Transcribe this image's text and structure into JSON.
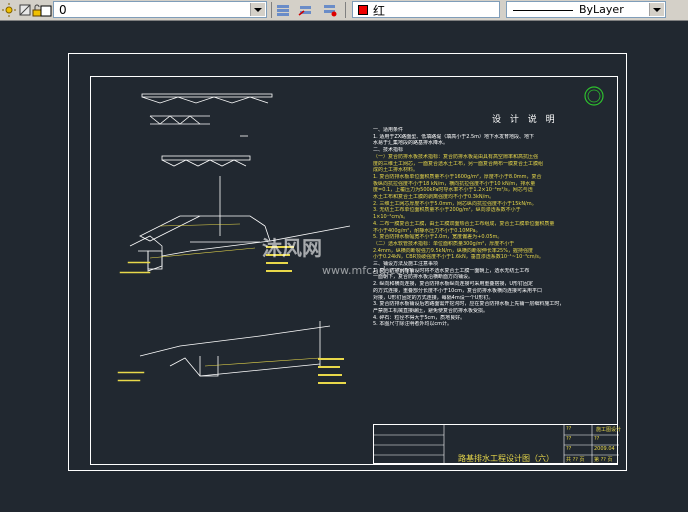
{
  "toolbar": {
    "layer_value": "0",
    "color_value": "红",
    "color_hex": "#e00000",
    "linetype_value": "ByLayer",
    "icons": [
      "sun-icon",
      "lock-icon",
      "layer-color-icon",
      "layer-props-icon",
      "layer-prev-icon",
      "layer-state-icon"
    ]
  },
  "drawing": {
    "title": "设 计 说 明",
    "notes": [
      {
        "t": "一、适用条件",
        "c": "w"
      },
      {
        "t": "1. 适用于ZX路面型、低填路堤（填高小于2.5m）地下水发育地段、地下",
        "c": "w"
      },
      {
        "t": "水易于汇集地段的路基排水降水。",
        "c": "w"
      },
      {
        "t": "二、技术指标",
        "c": "w"
      },
      {
        "t": "（一）复合防排水板技术指标：复合防排水板是由具有高空隙率和高抗压强",
        "c": "y"
      },
      {
        "t": "度的三维土工网芯，一面复合透水土工布，另一面复合两布一膜复合土工膜组",
        "c": "y"
      },
      {
        "t": "成的土工排水材料。",
        "c": "y"
      },
      {
        "t": "1. 复合防排水板单位面积质量不小于1600g/m²，厚度不小于8.0mm，复合",
        "c": "y"
      },
      {
        "t": "板纵向抗拉强度不小于18 kN/m，横向抗拉强度不小于10 kN/m，排水量",
        "c": "y"
      },
      {
        "t": "度=0.1，上覆压力为500kPa时导水率不小于1.2×10⁻⁴m²/s，网芯与透",
        "c": "y"
      },
      {
        "t": "水土工布和复合土工膜的剥离强度均不小于0.3kN/m。",
        "c": "y"
      },
      {
        "t": "2. 三维土工网芯厚度不小于5.0mm，网芯纵向抗拉强度不小于15kN/m。",
        "c": "y"
      },
      {
        "t": "3. 无纺土工布单位面积质量不小于200g/m²，纵向渗透系数不小于",
        "c": "y"
      },
      {
        "t": "1×10⁻²cm/s。",
        "c": "y"
      },
      {
        "t": "4. 二布一膜复合土工膜，由土工膜双面热合土工布组成，复合土工膜单位面积质量",
        "c": "y"
      },
      {
        "t": "不小于400g/m²，耐静水压力不小于0.10MPa。",
        "c": "y"
      },
      {
        "t": "5. 复合防排水板幅宽不小于2.0m，宽度偏差为+0.05m。",
        "c": "y"
      },
      {
        "t": "（二）透水软管技术指标：单位面积质量300g/m²，厚度不小于",
        "c": "y"
      },
      {
        "t": "2.4mm，纵横向断裂强力9.5kN/m，纵横向断裂伸长率25%，握持强度",
        "c": "y"
      },
      {
        "t": "小于0.24kN，CBR顶破强度不小于1.6kN，垂直渗透系数10⁻¹~10⁻³cm/s。",
        "c": "y"
      },
      {
        "t": "三、铺设方法及施工注意事项",
        "c": "w"
      },
      {
        "t": "1. 复合防排水板铺设时将不透水复合土工膜一面朝上，透水无纺土工布",
        "c": "w"
      },
      {
        "t": "一面朝下，复合防排水板沿横断面方向铺设。",
        "c": "w"
      },
      {
        "t": "2. 纵向和横向连接，复合防排水板纵向连接可采用重叠搭接，U形钉固定",
        "c": "w"
      },
      {
        "t": "的方式连接，重叠部分长度不小于10cm，复合防排水板横向连接可采用平口",
        "c": "w"
      },
      {
        "t": "对接，U形钉固定的方式连接，每隔4m设一个U形钉。",
        "c": "w"
      },
      {
        "t": "3. 复合防排水板铺设后若路面需开挖沟时，应在复合防排水板上先铺一层细料施工时，",
        "c": "w"
      },
      {
        "t": "严禁施工机械直接碾压，避免使复合防排水板受损。",
        "c": "w"
      },
      {
        "t": "4. 碎石：粒径不得大于5cm，质地良好。",
        "c": "w"
      },
      {
        "t": "5. 本图尺寸除注明者外均以cm计。",
        "c": "w"
      }
    ],
    "watermark_main": "沐风网",
    "watermark_url": "www.mfcad.com",
    "footer_title": "路基排水工程设计图（六）",
    "footer_cells": [
      "施工图设计",
      "??",
      "??",
      "2009.04",
      "??",
      "??",
      "共 ?? 页",
      "第 ?? 页"
    ]
  }
}
